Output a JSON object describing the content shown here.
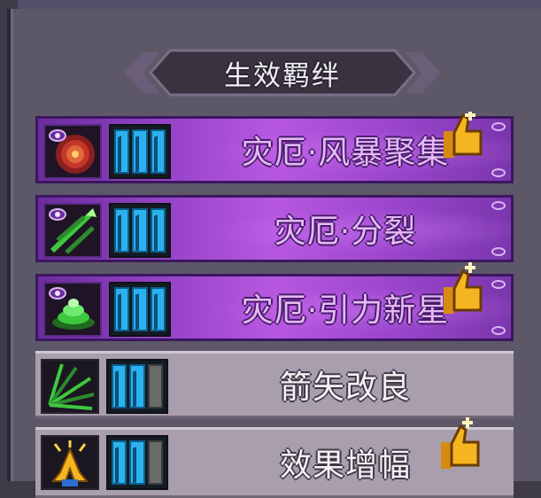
{
  "panel": {
    "title": "生效羁绊"
  },
  "colors": {
    "active_row": "#9a46cc",
    "inactive_row": "#a89eae",
    "level_bar": "#2bb2ee",
    "thumb": "#f5b520"
  },
  "bonds": [
    {
      "name": "灾厄·风暴聚集",
      "state": "active",
      "icon": "storm-vortex-icon",
      "levels_filled": 3,
      "levels_total": 3,
      "recommended": true
    },
    {
      "name": "灾厄·分裂",
      "state": "active",
      "icon": "split-arrows-icon",
      "levels_filled": 3,
      "levels_total": 3,
      "recommended": false
    },
    {
      "name": "灾厄·引力新星",
      "state": "active",
      "icon": "gravity-nova-icon",
      "levels_filled": 3,
      "levels_total": 3,
      "recommended": true
    },
    {
      "name": "箭矢改良",
      "state": "inactive",
      "icon": "arrow-spread-icon",
      "levels_filled": 2,
      "levels_total": 3,
      "recommended": false
    },
    {
      "name": "效果增幅",
      "state": "inactive",
      "icon": "praying-hands-icon",
      "levels_filled": 2,
      "levels_total": 3,
      "recommended": true
    }
  ]
}
